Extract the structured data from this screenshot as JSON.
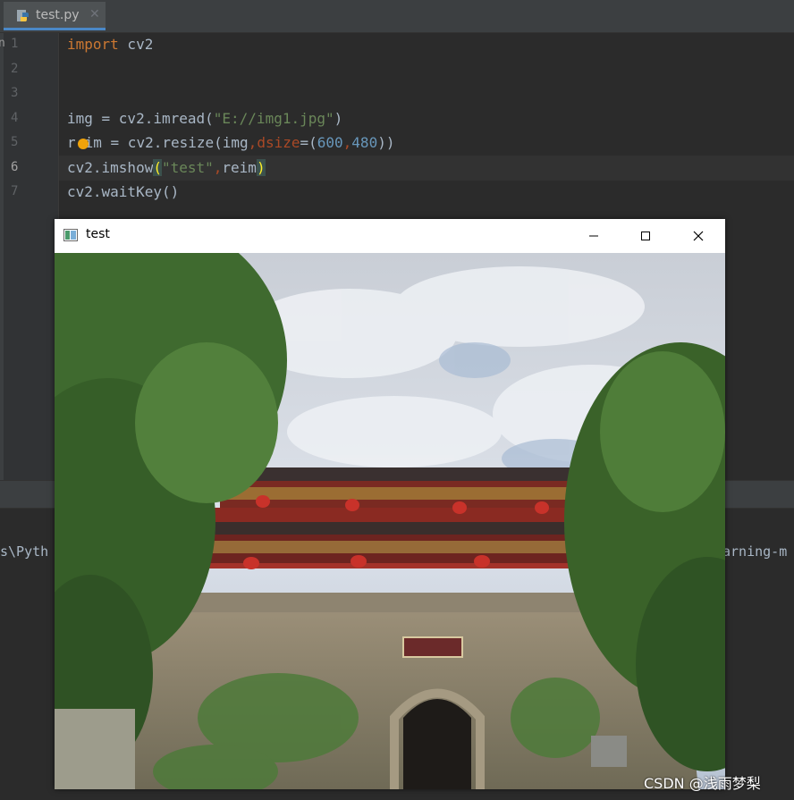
{
  "tab": {
    "label": "test.py",
    "close_glyph": "✕",
    "icon": "python-file-icon"
  },
  "gutter": {
    "marker": "n"
  },
  "lines": [
    "1",
    "2",
    "3",
    "4",
    "5",
    "6",
    "7"
  ],
  "code": {
    "l1_kw": "import",
    "l1_rest": " cv2",
    "l4_a": "img = cv2.imread(",
    "l4_str": "\"E://img1.jpg\"",
    "l4_b": ")",
    "l5_a": "r",
    "l5_b": "im = cv2.resize(img",
    "l5_comma1": ",",
    "l5_param": "dsize",
    "l5_c": "=(",
    "l5_n1": "600",
    "l5_comma2": ",",
    "l5_n2": "480",
    "l5_d": "))",
    "l6_a": "cv2.imshow",
    "l6_open": "(",
    "l6_str": "\"test\"",
    "l6_comma": ",",
    "l6_b": "reim",
    "l6_close": ")",
    "l7": "cv2.waitKey()"
  },
  "console": {
    "left_text": "s\\Pyth",
    "right_text": "arning-m"
  },
  "window": {
    "title": "test",
    "minimize": "minimize-icon",
    "maximize": "maximize-icon",
    "close": "close-icon"
  },
  "watermark": "CSDN @浅雨梦梨",
  "colors": {
    "keyword": "#cc7832",
    "string": "#6a8759",
    "number": "#6897bb",
    "param": "#aa4926",
    "text": "#a9b7c6"
  }
}
